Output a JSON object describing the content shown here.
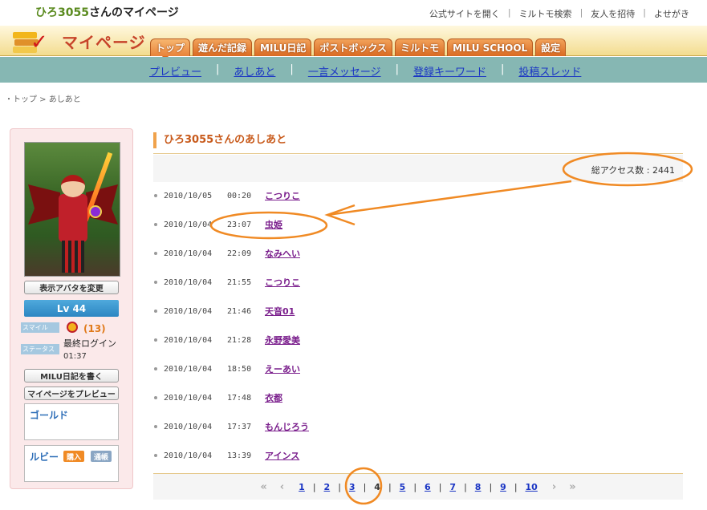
{
  "header": {
    "site_user": "ひろ3055",
    "site_suffix": "さんのマイページ",
    "links": [
      "公式サイトを開く",
      "ミルトモ検索",
      "友人を招待",
      "よせがき"
    ]
  },
  "tabbar": {
    "title": "マイページ",
    "tabs": [
      "トップ",
      "遊んだ記録",
      "MILU日記",
      "ポストボックス",
      "ミルトモ",
      "MILU SCHOOL",
      "設定"
    ]
  },
  "subnav": [
    "プレビュー",
    "あしあと",
    "一言メッセージ",
    "登録キーワード",
    "投稿スレッド"
  ],
  "breadcrumb": "・トップ > あしあと",
  "sidebar": {
    "change_avatar": "表示アバタを変更",
    "level": "Lv 44",
    "smile_label": "スマイル",
    "status_label": "ステータス",
    "smile_count": "(13)",
    "last_login_label": "最終ログイン",
    "last_login_time": "01:37",
    "write_diary": "MILU日記を書く",
    "preview_mypage": "マイページをプレビュー",
    "gold_label": "ゴールド",
    "ruby_label": "ルビー",
    "buy_badge": "購入",
    "history_badge": "通帳"
  },
  "main": {
    "heading": "ひろ3055さんのあしあと",
    "total_access": "総アクセス数 : 2441",
    "rows": [
      {
        "date": "2010/10/05",
        "time": "00:20",
        "user": "こつりこ"
      },
      {
        "date": "2010/10/04",
        "time": "23:07",
        "user": "虫姫"
      },
      {
        "date": "2010/10/04",
        "time": "22:09",
        "user": "なみへい"
      },
      {
        "date": "2010/10/04",
        "time": "21:55",
        "user": "こつりこ"
      },
      {
        "date": "2010/10/04",
        "time": "21:46",
        "user": "天音01"
      },
      {
        "date": "2010/10/04",
        "time": "21:28",
        "user": "永野愛美"
      },
      {
        "date": "2010/10/04",
        "time": "18:50",
        "user": "えーあい"
      },
      {
        "date": "2010/10/04",
        "time": "17:48",
        "user": "衣都"
      },
      {
        "date": "2010/10/04",
        "time": "17:37",
        "user": "もんじろう"
      },
      {
        "date": "2010/10/04",
        "time": "13:39",
        "user": "アインス"
      }
    ],
    "pager": {
      "first": "«",
      "prev": "‹",
      "pages": [
        "1",
        "2",
        "3",
        "4",
        "5",
        "6",
        "7",
        "8",
        "9",
        "10"
      ],
      "current": "4",
      "next": "›",
      "last": "»"
    }
  },
  "colors": {
    "accent": "#e07a1b",
    "subnav_bg": "#86b7b3",
    "link": "#1a35c4",
    "visitor": "#7a1e8c",
    "annotation": "#f08a24"
  }
}
